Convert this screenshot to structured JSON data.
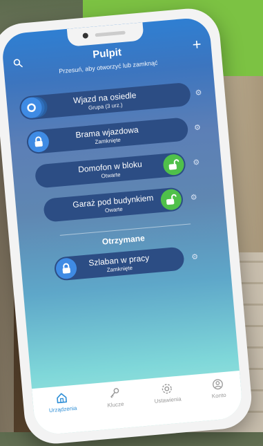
{
  "header": {
    "title": "Pulpit",
    "subtitle": "Przesuń, aby otworzyć lub zamknąć"
  },
  "devices": [
    {
      "name": "Wjazd na osiedle",
      "status": "Grupa (3 urz.)",
      "lock": "group",
      "color": "#3f8be4"
    },
    {
      "name": "Brama wjazdowa",
      "status": "Zamknięte",
      "lock": "closed",
      "color": "#3f8be4"
    },
    {
      "name": "Domofon w bloku",
      "status": "Otwarte",
      "lock": "open",
      "color": "#4fc04a"
    },
    {
      "name": "Garaż pod budynkiem",
      "status": "Owarte",
      "lock": "open",
      "color": "#4fc04a"
    }
  ],
  "received": {
    "title": "Otrzymane",
    "items": [
      {
        "name": "Szlaban w pracy",
        "status": "Zamknięte",
        "lock": "closed",
        "color": "#3f8be4"
      }
    ]
  },
  "tabs": [
    {
      "label": "Urządzenia",
      "icon": "home-icon",
      "active": true
    },
    {
      "label": "Klucze",
      "icon": "key-icon",
      "active": false
    },
    {
      "label": "Ustawienia",
      "icon": "gear-icon",
      "active": false
    },
    {
      "label": "Konto",
      "icon": "account-icon",
      "active": false
    }
  ],
  "colors": {
    "brand_green": "#7cc243",
    "accent_blue": "#2f8fd6",
    "card_bg": "#2c4d84"
  }
}
